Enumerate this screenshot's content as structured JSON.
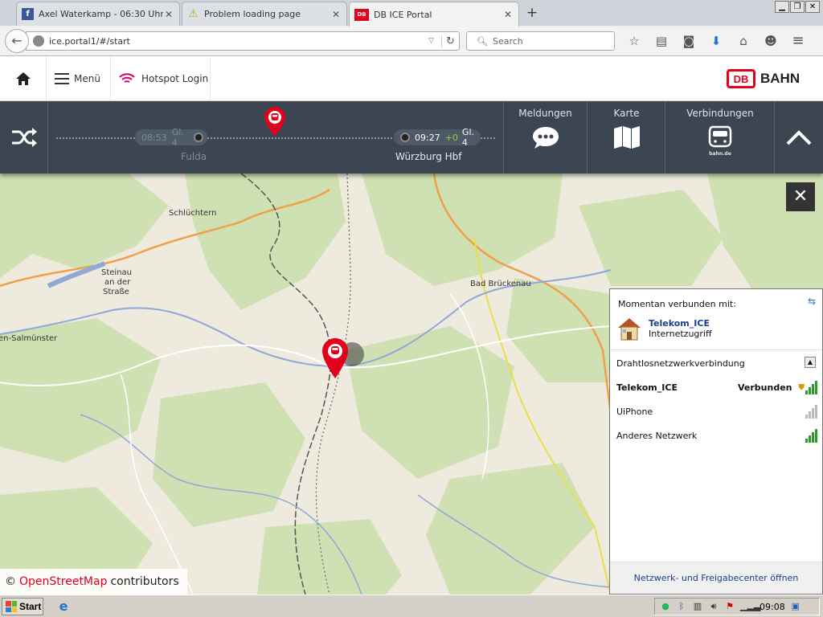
{
  "browser": {
    "tabs": [
      {
        "title": "Axel Waterkamp - 06:30 Uhr ..."
      },
      {
        "title": "Problem loading page"
      },
      {
        "title": "DB ICE Portal"
      }
    ],
    "url": "ice.portal1/#/start",
    "search_placeholder": "Search"
  },
  "portal": {
    "menu_label": "Menü",
    "hotspot_label": "Hotspot Login",
    "logo": {
      "mark": "DB",
      "word": "BAHN"
    },
    "trip": {
      "past_stop": {
        "time": "08:53",
        "track": "Gl. 4",
        "name": "Fulda"
      },
      "next_stop": {
        "time": "09:27",
        "delay": "+0",
        "track": "Gl. 4",
        "name": "Würzburg Hbf"
      }
    },
    "nav": {
      "meldungen": "Meldungen",
      "karte": "Karte",
      "verbindungen": "Verbindungen",
      "bahnde": "bahn.de"
    },
    "map": {
      "places": [
        "Schlüchtern",
        "Steinau",
        "an der",
        "Straße",
        "Bad Brückenau",
        "en-Salmünster"
      ],
      "attribution_prefix": "©",
      "attribution_link": "OpenStreetMap",
      "attribution_suffix": "contributors"
    }
  },
  "network_flyout": {
    "header": "Momentan verbunden mit:",
    "current": {
      "name": "Telekom_ICE",
      "type": "Internetzugriff"
    },
    "section": "Drahtlosnetzwerkverbindung",
    "networks": [
      {
        "name": "Telekom_ICE",
        "status": "Verbunden",
        "strength": 4
      },
      {
        "name": "UiPhone",
        "status": "",
        "strength": 0
      },
      {
        "name": "Anderes Netzwerk",
        "status": "",
        "strength": 4
      }
    ],
    "footer": "Netzwerk- und Freigabecenter öffnen"
  },
  "taskbar": {
    "start": "Start",
    "clock": "09:08"
  },
  "colors": {
    "db_red": "#e2001a",
    "infobar": "#3c4652",
    "map_green": "#cfe0b2"
  }
}
